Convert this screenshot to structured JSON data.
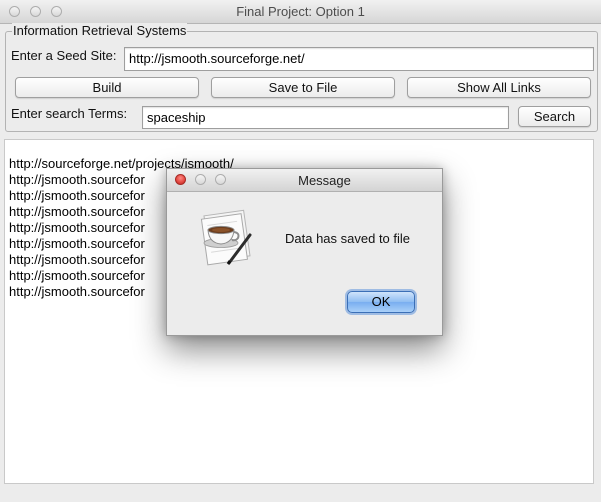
{
  "window": {
    "title": "Final Project: Option 1"
  },
  "panel": {
    "group_title": "Information Retrieval Systems",
    "seed_label": "Enter a Seed Site:",
    "seed_value": "http://jsmooth.sourceforge.net/",
    "build_label": "Build",
    "save_label": "Save to File",
    "show_links_label": "Show All Links",
    "search_label": "Enter search Terms:",
    "search_value": "spaceship",
    "search_button_label": "Search"
  },
  "results": [
    "http://sourceforge.net/projects/jsmooth/",
    "http://jsmooth.sourcefor",
    "http://jsmooth.sourcefor",
    "http://jsmooth.sourcefor",
    "http://jsmooth.sourcefor",
    "http://jsmooth.sourcefor",
    "http://jsmooth.sourcefor",
    "http://jsmooth.sourcefor",
    "http://jsmooth.sourcefor"
  ],
  "dialog": {
    "title": "Message",
    "message": "Data has saved to file",
    "ok_label": "OK",
    "icon": "coffee-cup-icon"
  },
  "colors": {
    "close_red": "#e2463f",
    "ok_blue": "#79aef0"
  }
}
